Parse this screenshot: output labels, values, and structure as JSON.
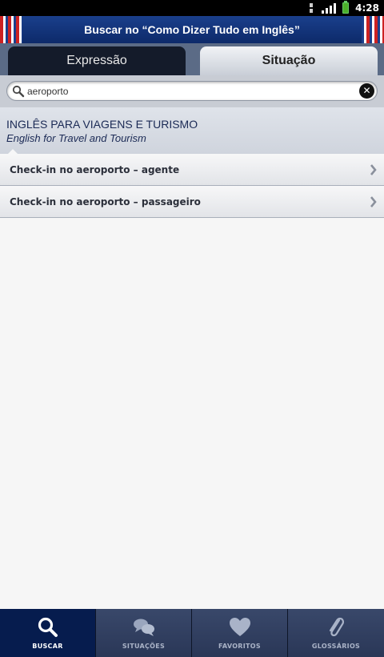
{
  "status_bar": {
    "time": "4:28"
  },
  "title_bar": {
    "title": "Buscar no “Como Dizer Tudo em Inglês”"
  },
  "tabs": [
    {
      "label": "Expressão",
      "selected": false
    },
    {
      "label": "Situação",
      "selected": true
    }
  ],
  "search": {
    "value": "aeroporto",
    "placeholder": ""
  },
  "section": {
    "title": "INGLÊS PARA VIAGENS E TURISMO",
    "subtitle": "English for Travel and Tourism"
  },
  "results": [
    {
      "label": "Check-in no aeroporto – agente"
    },
    {
      "label": "Check-in no aeroporto – passageiro"
    }
  ],
  "bottom_nav": [
    {
      "label": "BUSCAR",
      "icon": "search-icon",
      "active": true
    },
    {
      "label": "SITUAÇÕES",
      "icon": "speech-bubbles-icon",
      "active": false
    },
    {
      "label": "FAVORITOS",
      "icon": "heart-icon",
      "active": false
    },
    {
      "label": "GLOSSÁRIOS",
      "icon": "paperclip-icon",
      "active": false
    }
  ],
  "colors": {
    "title_bar": "#1a3f8c",
    "active_nav": "#061c4e",
    "section_text": "#1b2a55"
  }
}
